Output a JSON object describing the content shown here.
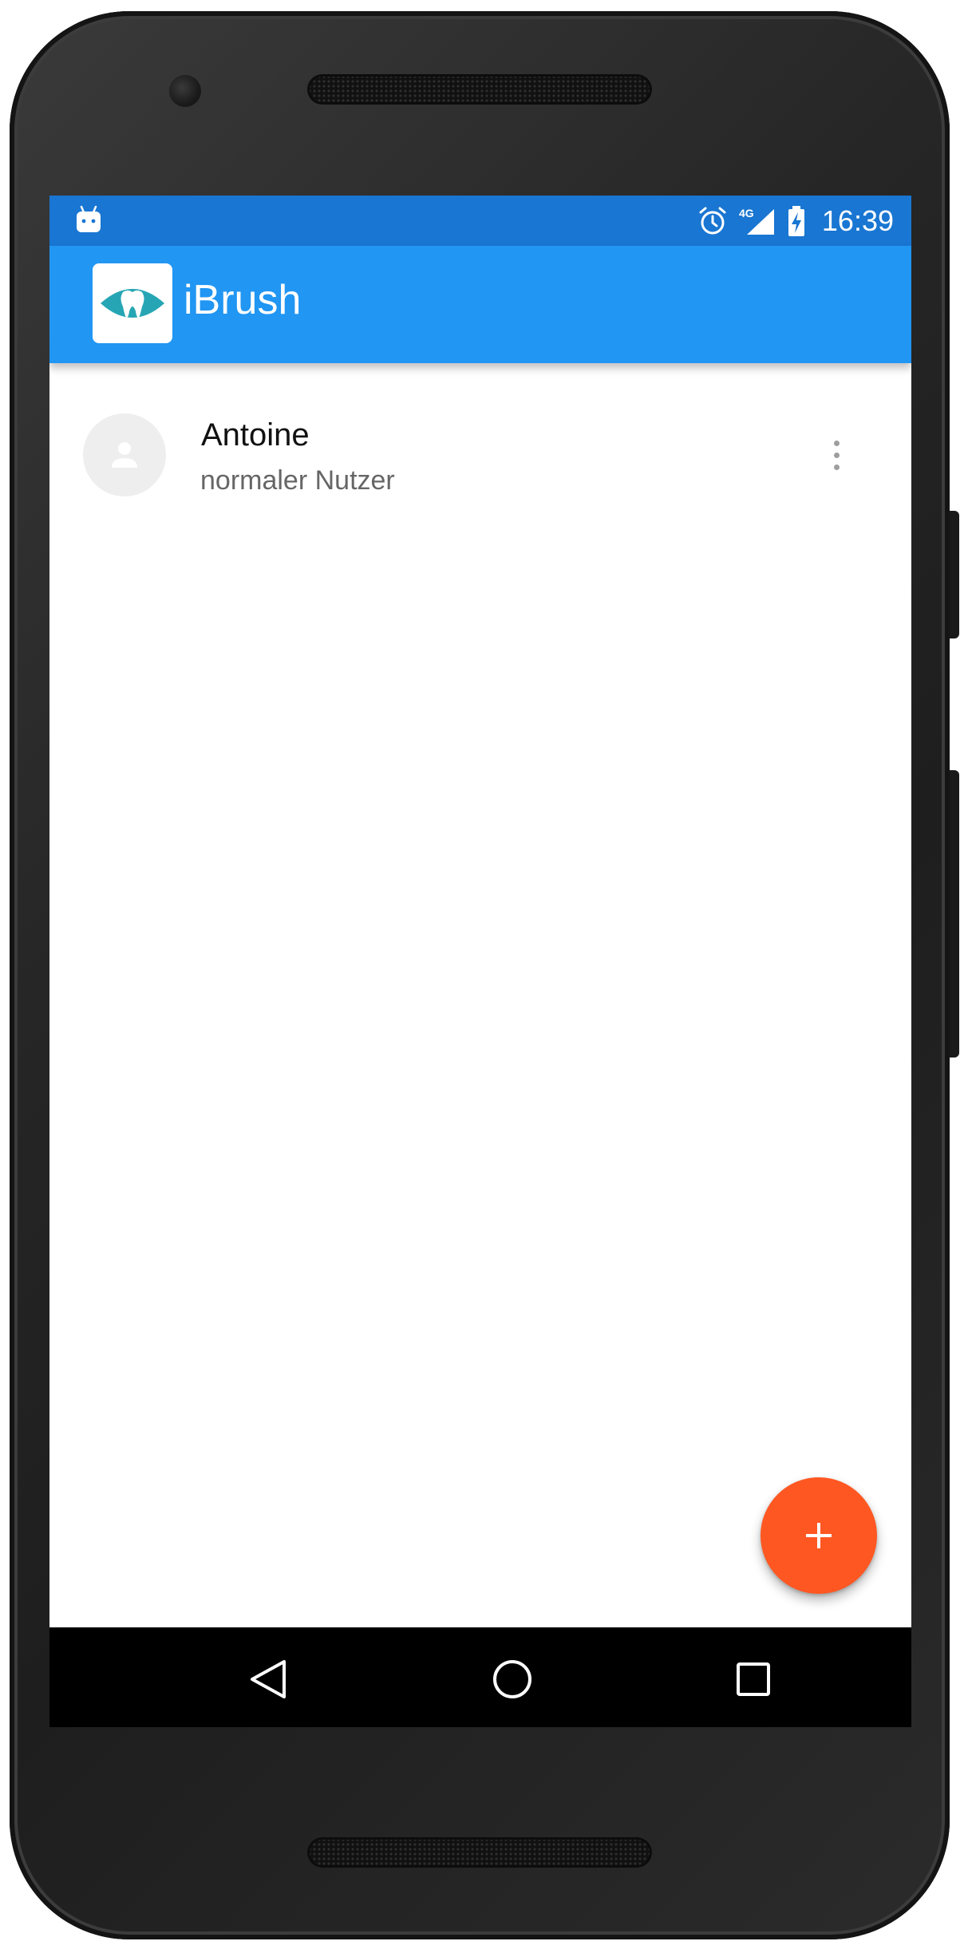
{
  "status_bar": {
    "time": "16:39",
    "network": "4G",
    "icons": [
      "android-icon",
      "alarm-icon",
      "signal-icon",
      "battery-charging-icon"
    ]
  },
  "app_bar": {
    "title": "iBrush",
    "logo_icon": "tooth-logo-icon",
    "background_color": "#2196F3",
    "status_color": "#1976D2"
  },
  "users": [
    {
      "name": "Antoine",
      "role": "normaler Nutzer",
      "avatar_icon": "person-icon",
      "menu_icon": "more-vert-icon"
    }
  ],
  "fab": {
    "icon": "plus-icon",
    "color": "#FF5722"
  },
  "navigation": {
    "items": [
      "back-icon",
      "home-icon",
      "recent-apps-icon"
    ]
  }
}
